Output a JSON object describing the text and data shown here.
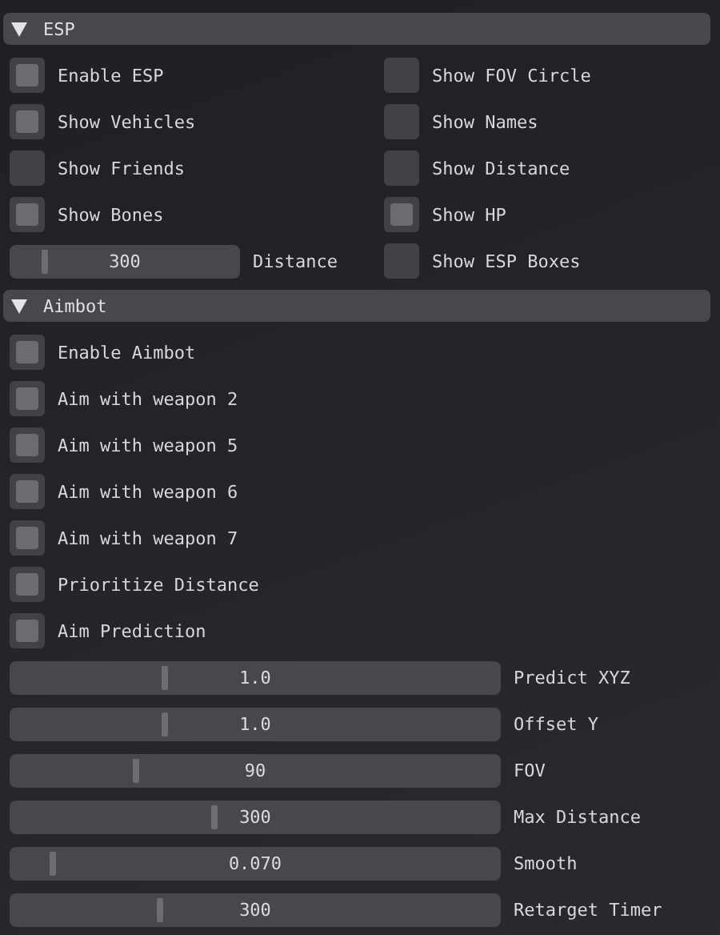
{
  "sections": [
    {
      "title": "ESP",
      "expanded": true,
      "rows": [
        [
          {
            "kind": "checkbox",
            "label": "Enable ESP",
            "checked": true
          },
          {
            "kind": "checkbox",
            "label": "Show FOV Circle",
            "checked": false
          }
        ],
        [
          {
            "kind": "checkbox",
            "label": "Show Vehicles",
            "checked": true
          },
          {
            "kind": "checkbox",
            "label": "Show Names",
            "checked": false
          }
        ],
        [
          {
            "kind": "checkbox",
            "label": "Show Friends",
            "checked": false
          },
          {
            "kind": "checkbox",
            "label": "Show Distance",
            "checked": false
          }
        ],
        [
          {
            "kind": "checkbox",
            "label": "Show Bones",
            "checked": true
          },
          {
            "kind": "checkbox",
            "label": "Show HP",
            "checked": true
          }
        ],
        [
          {
            "kind": "slider",
            "label": "Distance",
            "value": "300",
            "level": 0.14
          },
          {
            "kind": "checkbox",
            "label": "Show ESP Boxes",
            "checked": false
          }
        ]
      ]
    },
    {
      "title": "Aimbot",
      "expanded": true,
      "items": [
        {
          "kind": "checkbox",
          "label": "Enable Aimbot",
          "checked": true
        },
        {
          "kind": "checkbox",
          "label": "Aim with weapon 2",
          "checked": true
        },
        {
          "kind": "checkbox",
          "label": "Aim with weapon 5",
          "checked": true
        },
        {
          "kind": "checkbox",
          "label": "Aim with weapon 6",
          "checked": true
        },
        {
          "kind": "checkbox",
          "label": "Aim with weapon 7",
          "checked": true
        },
        {
          "kind": "checkbox",
          "label": "Prioritize Distance",
          "checked": true
        },
        {
          "kind": "checkbox",
          "label": "Aim Prediction",
          "checked": true
        },
        {
          "kind": "slider",
          "label": "Predict XYZ",
          "value": "1.0",
          "level": 0.31
        },
        {
          "kind": "slider",
          "label": "Offset Y",
          "value": "1.0",
          "level": 0.31
        },
        {
          "kind": "slider",
          "label": "FOV",
          "value": "90",
          "level": 0.25
        },
        {
          "kind": "slider",
          "label": "Max Distance",
          "value": "300",
          "level": 0.41
        },
        {
          "kind": "slider",
          "label": "Smooth",
          "value": "0.070",
          "level": 0.08
        },
        {
          "kind": "slider",
          "label": "Retarget Timer",
          "value": "300",
          "level": 0.3
        }
      ]
    }
  ]
}
